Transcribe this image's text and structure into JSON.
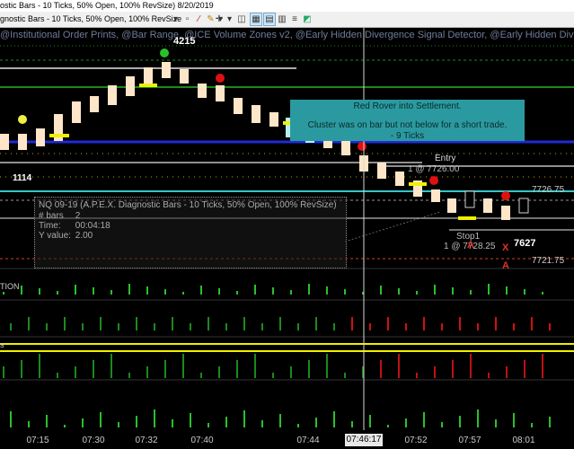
{
  "window": {
    "title": "ostic Bars - 10 Ticks, 50% Open, 100% RevSize)  8/20/2019"
  },
  "toolbar": {
    "instrument_label": "gnostic Bars - 10 Ticks, 50% Open, 100% RevSize",
    "buttons": [
      {
        "name": "bar-type-icon",
        "glyph": "▾"
      },
      {
        "name": "drawing-tool-icon",
        "glyph": "▫"
      },
      {
        "name": "line-tool-icon",
        "glyph": "⁄"
      },
      {
        "name": "pencil-icon",
        "glyph": "✎"
      },
      {
        "name": "draw-menu-icon",
        "glyph": "▾"
      },
      {
        "name": "crosshair-icon",
        "glyph": "✛"
      },
      {
        "name": "crosshair-menu-icon",
        "glyph": "▾"
      },
      {
        "name": "chart-trader-icon",
        "glyph": "◫"
      },
      {
        "name": "template-icon",
        "glyph": "▦"
      },
      {
        "name": "data-box-icon",
        "glyph": "▤"
      },
      {
        "name": "properties-icon",
        "glyph": "▥"
      },
      {
        "name": "indicators-icon",
        "glyph": "≡"
      },
      {
        "name": "strategies-icon",
        "glyph": "◩"
      }
    ]
  },
  "chart": {
    "indicator_list": "@Institutional Order Prints, @Bar Range, @ICE Volume Zones v2, @Early Hidden Divergence Signal Detector, @Early Hidden Divergence S",
    "labels": {
      "high_price": "4215",
      "low_price": "1114",
      "entry": "Entry",
      "entry_price": "1 @ 7726.00",
      "stop": "Stop1",
      "stop_price": "1 @ 7728.25",
      "last_price": "7627",
      "price_7726": "7726.75",
      "price_7721": "7721.75",
      "marker_a1": "A",
      "marker_a2": "A",
      "marker_x": "X",
      "panel_label_1": "TION",
      "panel_label_2": "s"
    },
    "infobox": {
      "title": "NQ 09-19 (A.P.E.X. Diagnostic Bars - 10 Ticks, 50% Open, 100% RevSize)",
      "bars_key": "# bars",
      "bars_val": "2",
      "time_key": "Time:",
      "time_val": "00:04:18",
      "y_key": "Y value:",
      "y_val": "2.00"
    },
    "note": {
      "line1": "Red Rover into Settlement.",
      "line2": "Cluster was on bar but not below for a short trade.",
      "line3": "- 9 Ticks"
    },
    "colors": {
      "up_candle": "#ffe6c8",
      "highlight_candle": "#b8f0ec",
      "blue_line": "#1f2dd6",
      "green_line": "#1a8a1a",
      "yellow": "#f0f000",
      "cyan": "#34c6c6",
      "teal_note": "#2b9aa0"
    }
  },
  "time_axis": {
    "ticks": [
      "07:15",
      "07:30",
      "07:32",
      "07:40",
      "07:44",
      "07:52",
      "07:57",
      "08:01"
    ],
    "cursor_time": "07:46:17"
  }
}
